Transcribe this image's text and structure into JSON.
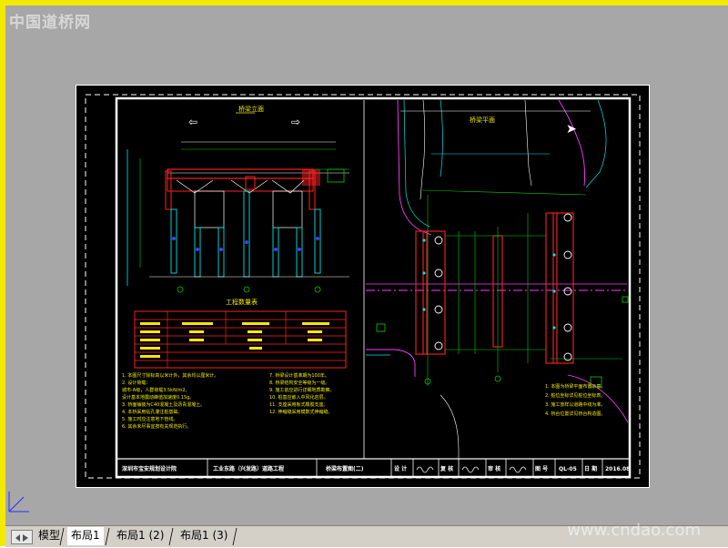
{
  "watermark": {
    "top_left": "中国道桥网",
    "bottom_right": "www.cndao.com"
  },
  "tabs": [
    {
      "label": "模型",
      "active": false
    },
    {
      "label": "布局1",
      "active": true
    },
    {
      "label": "布局1 (2)",
      "active": false
    },
    {
      "label": "布局1 (3)",
      "active": false
    }
  ],
  "drawing": {
    "elevation_title": "桥梁立面",
    "table_title": "工程数量表",
    "plan_title": "桥梁平面",
    "title_block": {
      "org": "深圳市宝安规划设计院",
      "project": "工业东路（兴发路）道路工程",
      "drawing_name": "桥梁布置图(二)",
      "design_label": "设 计",
      "review_label": "复 核",
      "check_label": "审 核",
      "sheet_no_label": "图 号",
      "sheet_no": "QL-05",
      "date_label": "日 期",
      "date": "2016.08"
    },
    "notes_left": [
      "1. 本图尺寸除标高以米计外，其余均以厘米计。",
      "2. 设计荷载：",
      "   城市-A级，人群荷载3.5kN/m2。",
      "   设计基本地震动峰值加速度0.15g。",
      "3. 桥面铺装为C40混凝土及沥青混凝土。",
      "4. 本桥采用钻孔灌注桩基础。",
      "5. 施工时应注意地下管线。",
      "6. 其余未尽事宜按有关规范执行。"
    ],
    "notes_middle": [
      "7. 桥梁设计基准期为100年。",
      "8. 桥梁结构安全等级为一级。",
      "9. 施工前应进行详细地质勘察。",
      "10. 桩基应嵌入中风化岩层。",
      "11. 支座采用板式橡胶支座。",
      "12. 伸缩缝采用模数式伸缩缝。"
    ],
    "notes_right": [
      "1. 本图为桥梁平面布置示意。",
      "2. 桩位坐标详见桩位坐标表。",
      "3. 施工放样以道路中线为准。",
      "4. 桥台位置详见桥台构造图。"
    ]
  },
  "colors": {
    "yellow": "#f2ea00",
    "red": "#ff2020",
    "cyan": "#00e5e5",
    "green": "#00d000",
    "magenta": "#ff3cff",
    "white": "#ffffff",
    "blue": "#4040ff"
  }
}
